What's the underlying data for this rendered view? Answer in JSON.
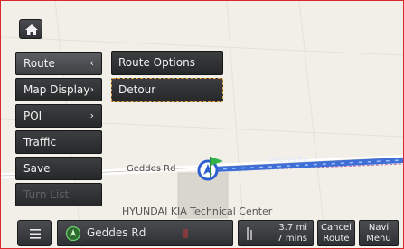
{
  "side_menu": {
    "items": [
      {
        "label": "Route",
        "arrow": "‹"
      },
      {
        "label": "Map Display",
        "arrow": "›"
      },
      {
        "label": "POI",
        "arrow": "›"
      },
      {
        "label": "Traffic",
        "arrow": ""
      },
      {
        "label": "Save",
        "arrow": ""
      },
      {
        "label": "Turn List",
        "arrow": ""
      }
    ]
  },
  "route_submenu": {
    "items": [
      {
        "label": "Route Options"
      },
      {
        "label": "Detour"
      }
    ]
  },
  "map": {
    "road_label": "Geddes Rd",
    "route_label": "Geddes Rd",
    "poi_label": "HYUNDAI KIA Technical Center"
  },
  "bottom_bar": {
    "current_road": "Geddes Rd",
    "distance": "3.7 mi",
    "time": "7 mins",
    "cancel_route": "Cancel Route",
    "navi_menu": "Navi Menu"
  },
  "colors": {
    "route_line": "#3f6fd6",
    "focus_outline": "#e8a23c",
    "frame_border": "#d8282e"
  },
  "icons": [
    "home-icon",
    "list-icon",
    "vehicle-position-icon",
    "destination-flag-icon",
    "compass-icon",
    "route-progress-icon"
  ]
}
